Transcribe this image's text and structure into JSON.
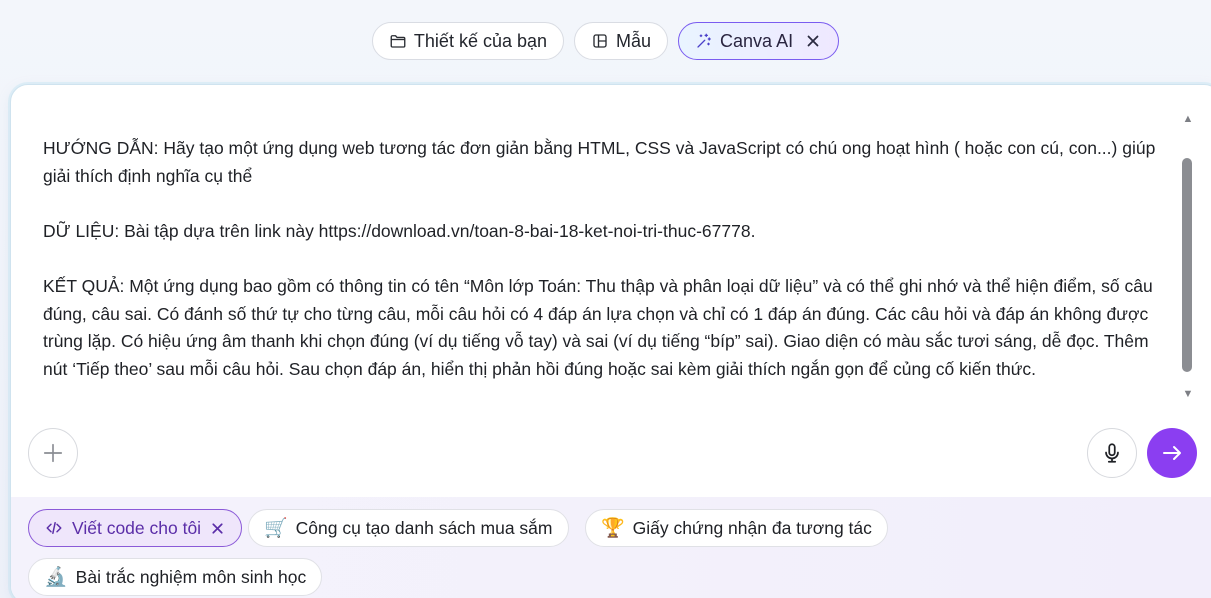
{
  "tabs": [
    {
      "label": "Thiết kế của bạn",
      "icon": "folder-icon"
    },
    {
      "label": "Mẫu",
      "icon": "template-icon"
    },
    {
      "label": "Canva AI",
      "icon": "sparkle-icon",
      "active": true
    }
  ],
  "prompt": {
    "paragraphs": [
      "HƯỚNG DẪN: Hãy tạo một ứng dụng web tương tác đơn giản bằng HTML, CSS và JavaScript có chú ong hoạt hình ( hoặc con cú, con...) giúp giải thích định nghĩa cụ thể",
      "DỮ LIỆU: Bài tập dựa trên link này https://download.vn/toan-8-bai-18-ket-noi-tri-thuc-67778.",
      "KẾT QUẢ: Một ứng dụng bao gồm có thông tin có tên “Môn lớp Toán: Thu thập và phân loại dữ liệu” và có thể ghi nhớ và thể hiện điểm, số câu đúng, câu sai. Có đánh số thứ tự cho từng câu, mỗi câu hỏi có 4 đáp án lựa chọn và chỉ có 1 đáp án đúng. Các câu hỏi và đáp án không được trùng lặp. Có hiệu ứng âm thanh khi chọn đúng (ví dụ tiếng vỗ tay) và sai (ví dụ tiếng “bíp” sai). Giao diện có màu sắc tươi sáng, dễ đọc. Thêm nút ‘Tiếp theo’ sau mỗi câu hỏi. Sau chọn đáp án, hiển thị phản hồi đúng hoặc sai kèm giải thích ngắn gọn để củng cố kiến thức."
    ]
  },
  "suggestions": [
    {
      "label": "Viết code cho tôi",
      "icon": "code-icon",
      "active": true
    },
    {
      "label": "Công cụ tạo danh sách mua sắm",
      "icon": "shopping-cart-icon"
    },
    {
      "label": "Giấy chứng nhận đa tương tác",
      "icon": "trophy-icon"
    },
    {
      "label": "Bài trắc nghiệm môn sinh học",
      "icon": "microscope-icon"
    }
  ],
  "colors": {
    "accent": "#8b3ef1",
    "active_chip": "#efe6fb",
    "active_chip_text": "#5b2ea8"
  }
}
